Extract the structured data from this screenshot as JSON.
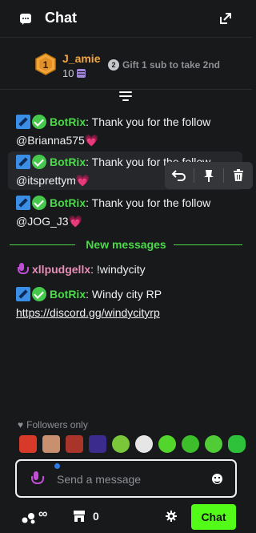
{
  "header": {
    "title": "Chat"
  },
  "leaderboard": {
    "rank_number": "1",
    "top_user": "J_amie",
    "top_count": "10",
    "second_rank": "2",
    "second_text": "Gift 1 sub to take 2nd"
  },
  "messages": [
    {
      "user": "BotRix",
      "colon": ":",
      "text": "Thank you for the follow",
      "mention": "@Brianna575",
      "emoji": "💗"
    },
    {
      "user": "BotRix",
      "colon": ":",
      "text": "Thank you for the follow",
      "mention": "@itsprettym",
      "emoji": "💗"
    },
    {
      "user": "BotRix",
      "colon": ":",
      "text": "Thank you for the follow",
      "mention": "@JOG_J3",
      "emoji": "💗"
    }
  ],
  "divider": {
    "label": "New messages"
  },
  "new_messages": [
    {
      "user": "xllpudgellx",
      "colon": ":",
      "text": "!windycity"
    },
    {
      "user": "BotRix",
      "colon": ":",
      "text": "Windy city RP",
      "link": "https://discord.gg/windycityrp"
    }
  ],
  "footer": {
    "followers_only": "Followers only",
    "input_placeholder": "Send a message",
    "points_value": "∞",
    "store_count": "0",
    "chat_button": "Chat"
  },
  "colors": {
    "accent": "#53fc18",
    "bot_name": "#4bd94a",
    "user2_name": "#e88fb8",
    "leader_name": "#f2a63b"
  },
  "emotes": [
    "angry-face",
    "man-face",
    "bearded-face",
    "dance-figure",
    "halo-face",
    "clown-face",
    "green-smile",
    "green-grin",
    "green-headphones",
    "green-blob"
  ]
}
